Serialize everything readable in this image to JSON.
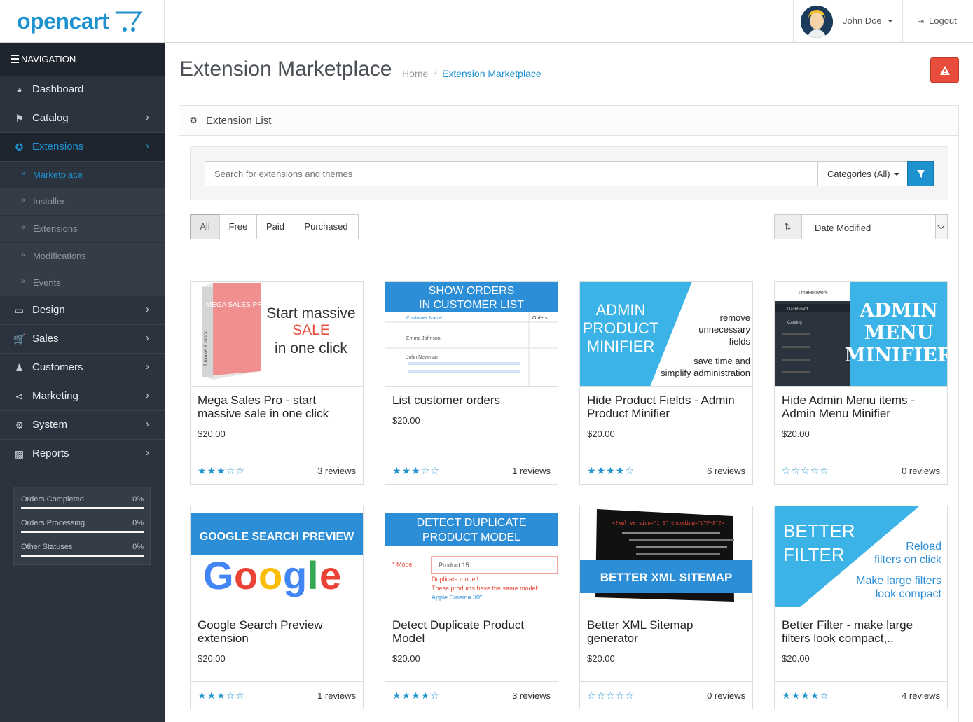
{
  "header": {
    "logo": "opencart",
    "user_name": "John Doe",
    "logout": "Logout"
  },
  "sidebar": {
    "nav_header": "NAVIGATION",
    "items": [
      {
        "label": "Dashboard",
        "icon": "dashboard-icon"
      },
      {
        "label": "Catalog",
        "icon": "tag-icon"
      },
      {
        "label": "Extensions",
        "icon": "puzzle-icon"
      },
      {
        "label": "Design",
        "icon": "monitor-icon"
      },
      {
        "label": "Sales",
        "icon": "cart-icon"
      },
      {
        "label": "Customers",
        "icon": "user-icon"
      },
      {
        "label": "Marketing",
        "icon": "share-icon"
      },
      {
        "label": "System",
        "icon": "cog-icon"
      },
      {
        "label": "Reports",
        "icon": "bar-chart-icon"
      }
    ],
    "sub_items": [
      "Marketplace",
      "Installer",
      "Extensions",
      "Modifications",
      "Events"
    ],
    "stats": [
      {
        "label": "Orders Completed",
        "value": "0%"
      },
      {
        "label": "Orders Processing",
        "value": "0%"
      },
      {
        "label": "Other Statuses",
        "value": "0%"
      }
    ]
  },
  "page": {
    "title": "Extension Marketplace",
    "breadcrumb_home": "Home",
    "breadcrumb_current": "Extension Marketplace"
  },
  "panel": {
    "heading": "Extension List",
    "search_placeholder": "Search for extensions and themes",
    "categories_label": "Categories (All)",
    "tabs": [
      "All",
      "Free",
      "Paid",
      "Purchased"
    ],
    "sort_label": "Date Modified"
  },
  "thumbs": {
    "t1_box": "MEGA SALES PRO",
    "t1_side": "I make it work",
    "t1_line1": "Start massive",
    "t1_line2": "SALE",
    "t1_line3": "in one click",
    "t2_line1": "SHOW ORDERS",
    "t2_line2": "IN CUSTOMER LIST",
    "t2_col1": "Customer Name",
    "t2_col2": "Orders",
    "t2_row1": "Emma Johnson",
    "t2_row2": "John Newman",
    "t3_line1": "ADMIN",
    "t3_line2": "PRODUCT",
    "t3_line3": "MINIFIER",
    "t3_r1": "remove",
    "t3_r2": "unnecessary",
    "t3_r3": "fields",
    "t3_r4": "save time and",
    "t3_r5": "simplify administration",
    "t4_line1": "ADMIN",
    "t4_line2": "MENU",
    "t4_line3": "MINIFIER",
    "t4_small": "I makeITwork",
    "t4_dash": "Dashboard",
    "t4_cat": "Catalog",
    "t5_head": "GOOGLE SEARCH PREVIEW",
    "t6_line1": "DETECT DUPLICATE",
    "t6_line2": "PRODUCT MODEL",
    "t6_label": "* Model",
    "t6_value": "Product 15",
    "t6_err1": "Duplicate model!",
    "t6_err2": "These products have the same model:",
    "t6_err3": "Apple Cinema 30\"",
    "t7_code": "<?xml version=\"1.0\" encoding=\"UTF-8\"?>",
    "t7_banner": "BETTER XML SITEMAP",
    "t8_line1": "BETTER",
    "t8_line2": "FILTER",
    "t8_r1": "Reload",
    "t8_r2": "filters on click",
    "t8_r3": "Make large filters",
    "t8_r4": "look compact"
  },
  "cards": [
    {
      "title": "Mega Sales Pro - start massive sale in one click",
      "price": "$20.00",
      "rating": 3,
      "reviews": "3 reviews"
    },
    {
      "title": "List customer orders",
      "price": "$20.00",
      "rating": 3,
      "reviews": "1 reviews"
    },
    {
      "title": "Hide Product Fields - Admin Product Minifier",
      "price": "$20.00",
      "rating": 4,
      "reviews": "6 reviews"
    },
    {
      "title": "Hide Admin Menu items - Admin Menu Minifier",
      "price": "$20.00",
      "rating": 0,
      "reviews": "0 reviews"
    },
    {
      "title": "Google Search Preview extension",
      "price": "$20.00",
      "rating": 3,
      "reviews": "1 reviews"
    },
    {
      "title": "Detect Duplicate Product Model",
      "price": "$20.00",
      "rating": 4,
      "reviews": "3 reviews"
    },
    {
      "title": "Better XML Sitemap generator",
      "price": "$20.00",
      "rating": 0,
      "reviews": "0 reviews"
    },
    {
      "title": "Better Filter - make large filters look compact,..",
      "price": "$20.00",
      "rating": 4,
      "reviews": "4 reviews"
    }
  ],
  "colors": {
    "accent": "#1e91cf",
    "sidebar": "#2b333e",
    "danger": "#e74c3c"
  }
}
